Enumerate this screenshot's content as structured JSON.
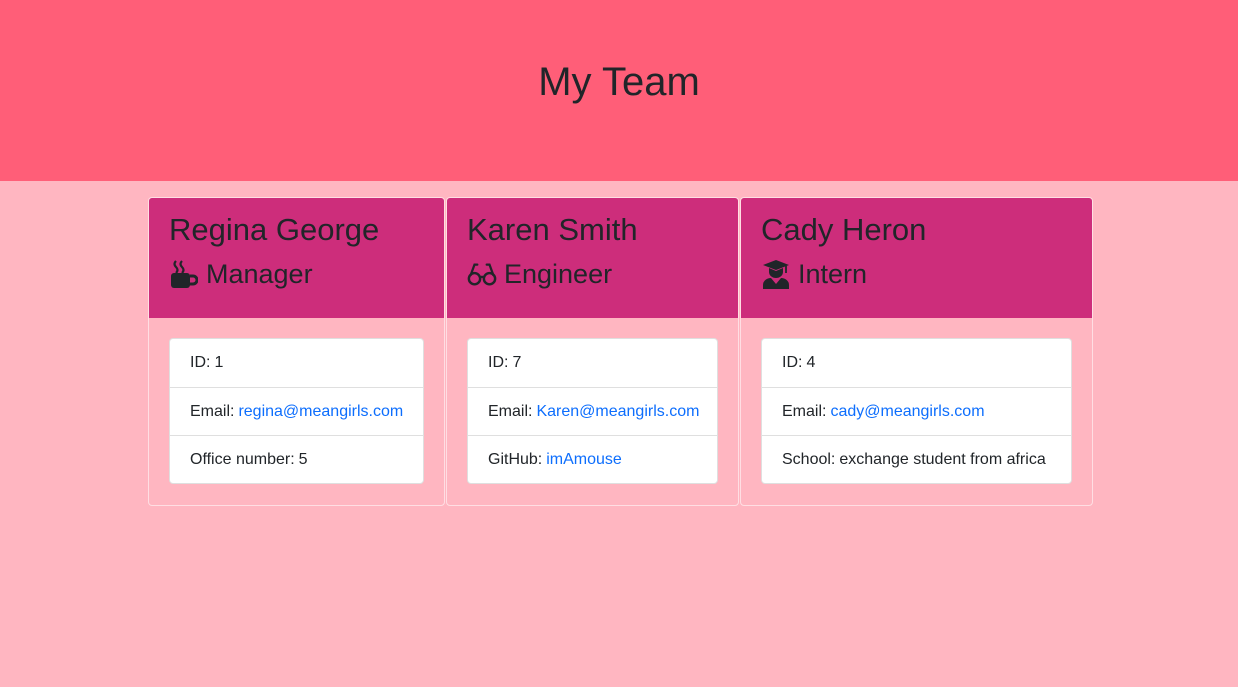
{
  "header": {
    "title": "My Team"
  },
  "team": [
    {
      "name": "Regina George",
      "role": "Manager",
      "icon": "coffee-icon",
      "id_label": "ID:",
      "id": "1",
      "email_label": "Email:",
      "email": "regina@meangirls.com",
      "extra_label": "Office number:",
      "extra_value": "5"
    },
    {
      "name": "Karen Smith",
      "role": "Engineer",
      "icon": "glasses-icon",
      "id_label": "ID:",
      "id": "7",
      "email_label": "Email:",
      "email": "Karen@meangirls.com",
      "extra_label": "GitHub:",
      "extra_value": "imAmouse"
    },
    {
      "name": "Cady Heron",
      "role": "Intern",
      "icon": "graduate-icon",
      "id_label": "ID:",
      "id": "4",
      "email_label": "Email:",
      "email": "cady@meangirls.com",
      "extra_label": "School:",
      "extra_value": "exchange student from africa"
    }
  ],
  "colors": {
    "header_bg": "#ff5e78",
    "page_bg": "#ffb6c1",
    "card_header_bg": "#cd2d7b",
    "link": "#0d6efd"
  }
}
